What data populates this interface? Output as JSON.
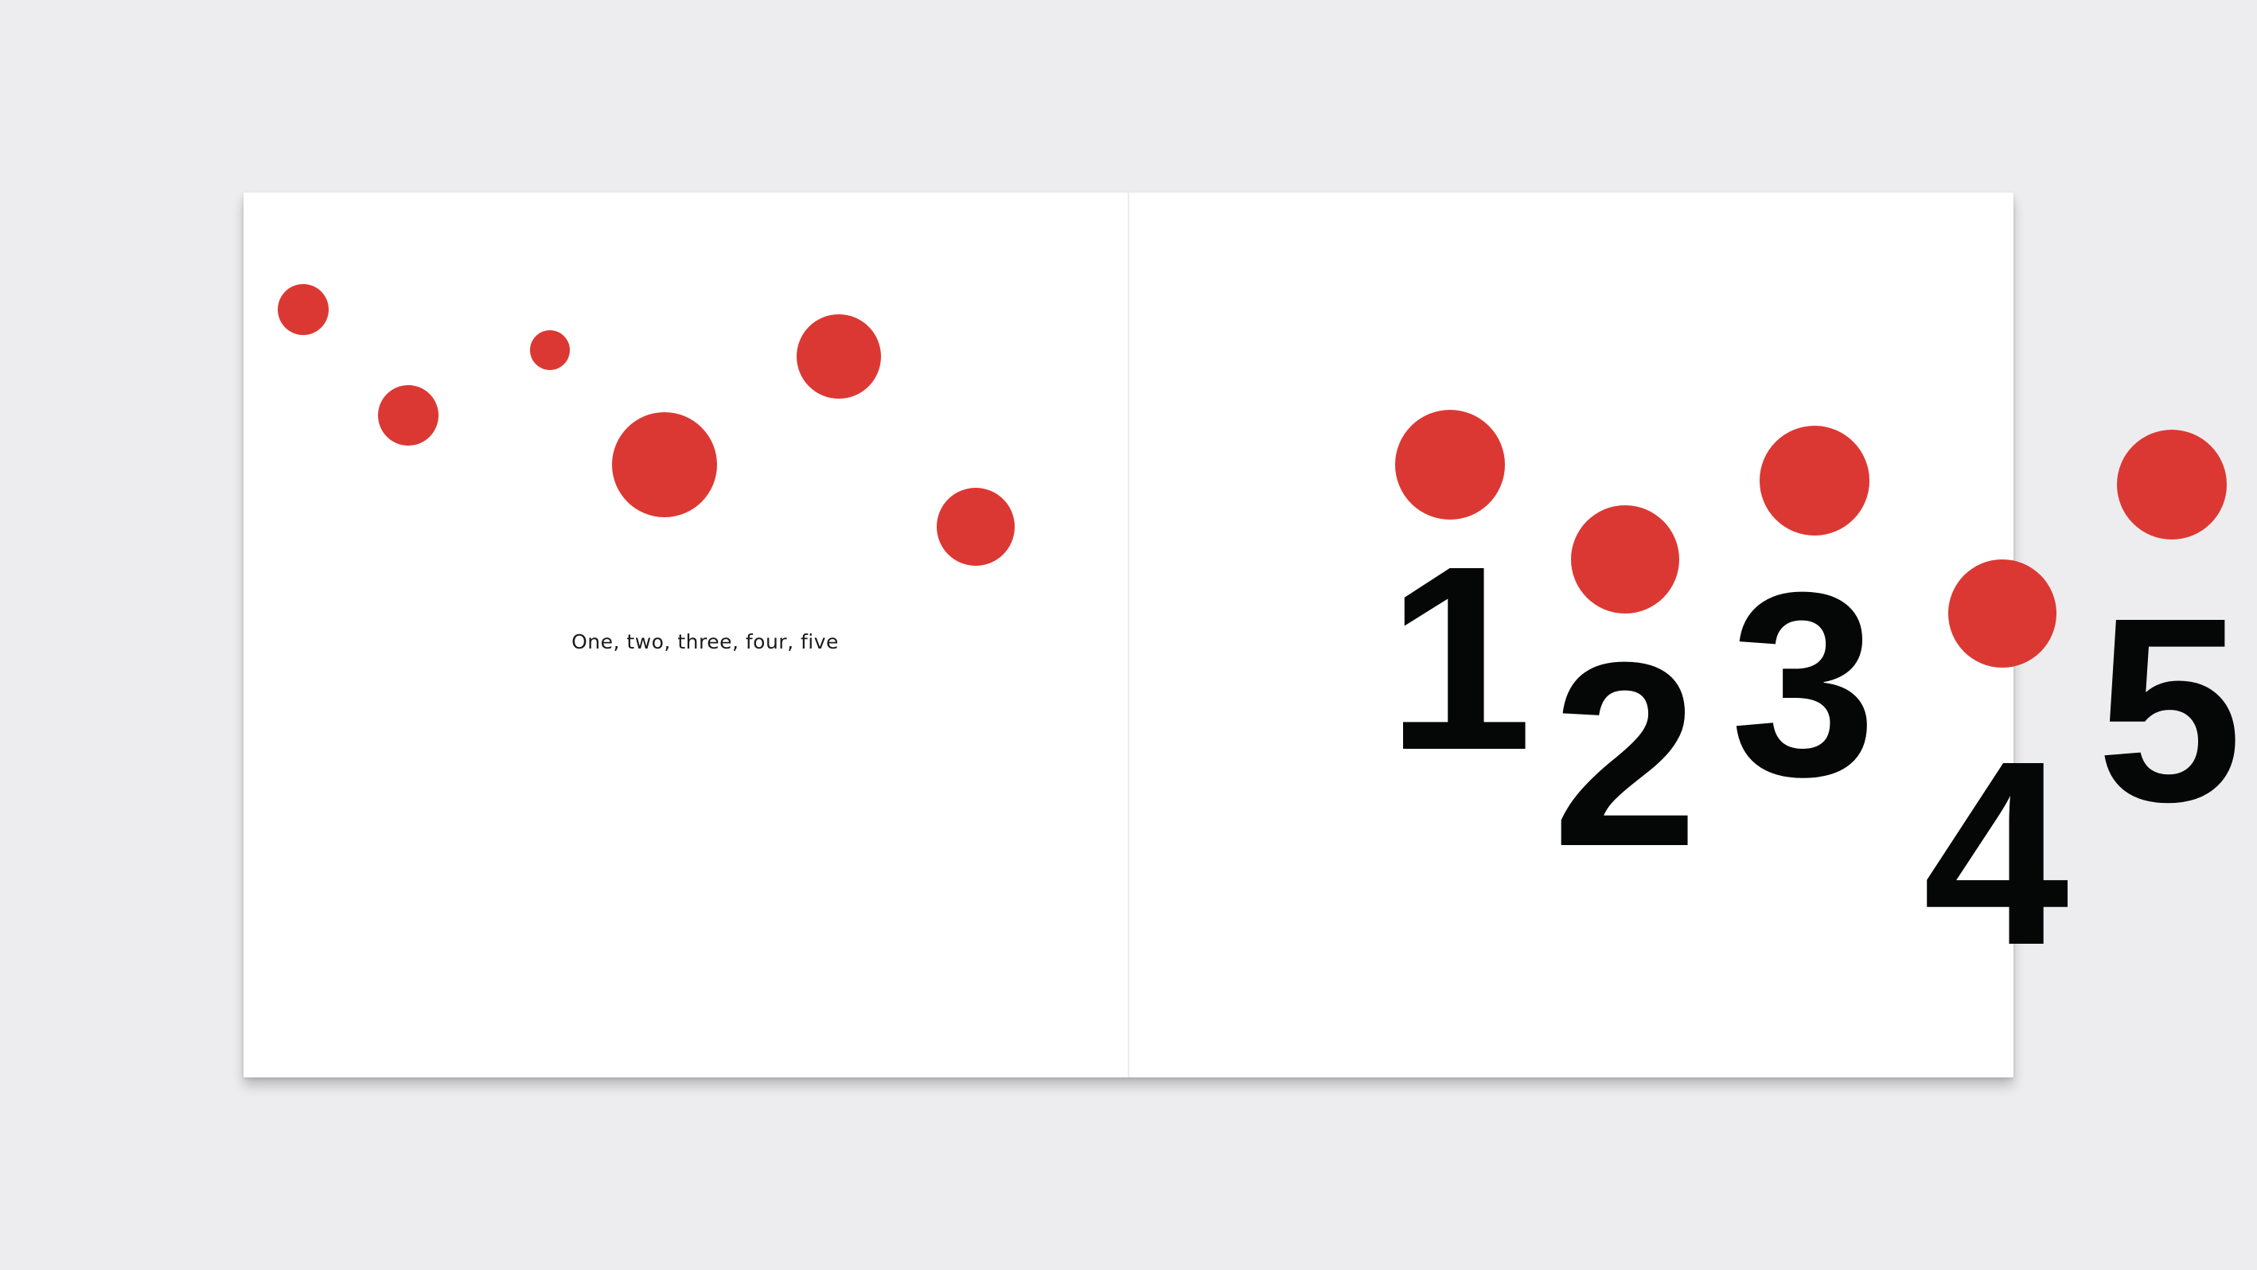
{
  "caption": "One, two, three, four, five",
  "numerals": [
    "1",
    "2",
    "3",
    "4",
    "5"
  ],
  "colors": {
    "dot": "#dc3833",
    "numeral": "#050706",
    "page": "#ffffff",
    "background": "#ededef"
  }
}
